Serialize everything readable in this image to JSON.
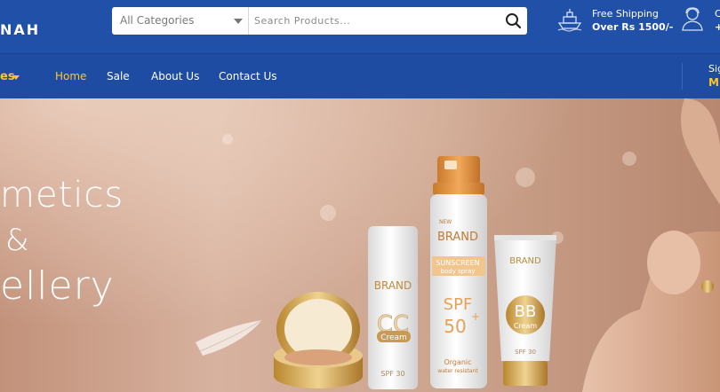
{
  "header": {
    "logo_text": "NAH",
    "search": {
      "category_label": "All Categories",
      "placeholder": "Search Products..."
    },
    "shipping": {
      "line1": "Free Shipping",
      "line2": "Over Rs 1500/-"
    },
    "account": {
      "line1": "C",
      "line2": "+"
    }
  },
  "nav": {
    "category_menu_label": "es",
    "links": [
      "Home",
      "Sale",
      "About Us",
      "Contact Us"
    ],
    "active_link": "Home",
    "signin": {
      "line1": "Sig",
      "line2": "M"
    }
  },
  "banner": {
    "line1": "metics",
    "line2": "&",
    "line3": "ellery",
    "products": {
      "spray_badge": "NEW",
      "spray_brand": "BRAND",
      "spray_type": "SUNSCREEN",
      "spray_sub": "body spray",
      "spray_spf": "SPF",
      "spray_spf_value": "50",
      "spray_plus": "+",
      "spray_foot1": "Organic",
      "spray_foot2": "water resistant",
      "cc_brand": "BRAND",
      "cc_letters": "CC",
      "cc_word": "Cream",
      "cc_spf": "SPF 30",
      "bb_brand": "BRAND",
      "bb_letters": "BB",
      "bb_word": "Cream",
      "bb_spf": "SPF 30"
    }
  },
  "colors": {
    "header_bg": "#2050a8",
    "nav_bg": "#1e4ca2",
    "accent": "#ffc629"
  }
}
